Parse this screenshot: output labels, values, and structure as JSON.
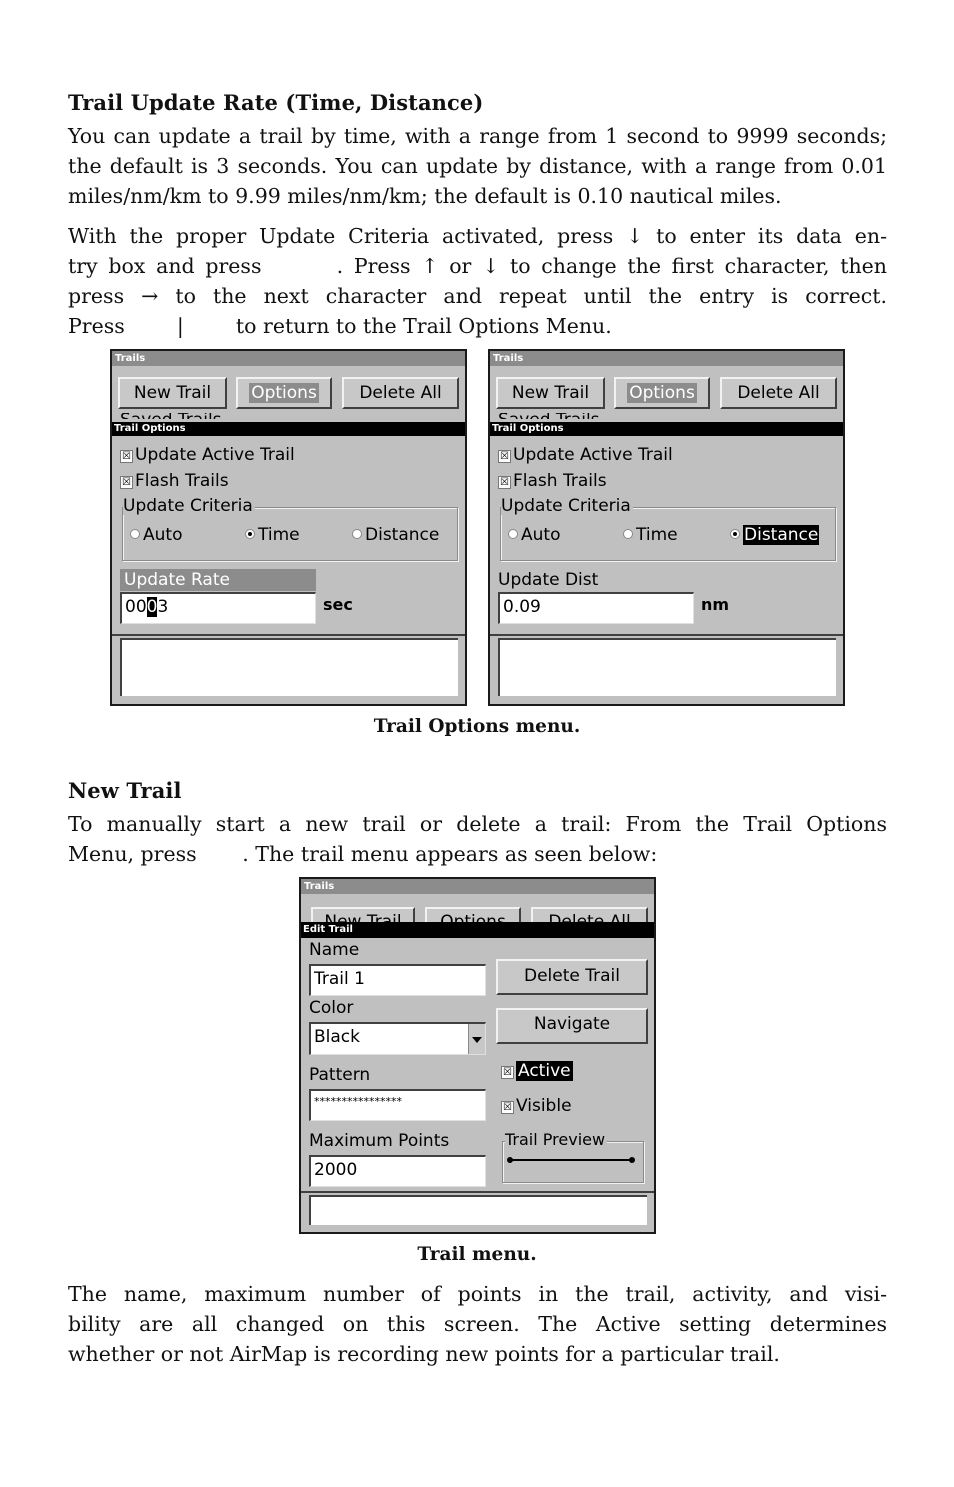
{
  "section1": {
    "heading": "Trail Update Rate (Time, Distance)",
    "para1_lines": [
      "You can update a trail by time, with a range from 1 second to 9999 seconds;",
      "the default is 3 seconds. You can update by distance, with a range from 0.01",
      "miles/nm/km to 9.99 miles/nm/km; the default is 0.10 nautical miles."
    ],
    "para2_lines": [
      "With the proper Update Criteria activated, press ↓ to enter its data en-",
      "try box and press       . Press ↑ or ↓ to change the first character, then",
      "press → to the next character and repeat until the entry is correct.",
      "Press        |        to return to the Trail Options Menu."
    ]
  },
  "figure1": {
    "caption": "Trail Options menu.",
    "screens": [
      {
        "title": "Trails",
        "buttons": {
          "new_trail": "New Trail",
          "options": "Options",
          "delete_all": "Delete All"
        },
        "partial_text": "Saved Trails",
        "submenu_title": "Trail Options",
        "checkboxes": [
          {
            "label": "Update Active Trail",
            "checked": true,
            "mark": "☒"
          },
          {
            "label": "Flash Trails",
            "checked": true,
            "mark": "☒"
          }
        ],
        "group_label": "Update Criteria",
        "radios": [
          {
            "label": "Auto",
            "selected": false
          },
          {
            "label": "Time",
            "selected": true
          },
          {
            "label": "Distance",
            "selected": false
          }
        ],
        "field_label": "Update Rate",
        "field_value_pre": "00",
        "field_value_cursor": "0",
        "field_value_post": "3",
        "unit": "sec"
      },
      {
        "title": "Trails",
        "buttons": {
          "new_trail": "New Trail",
          "options": "Options",
          "delete_all": "Delete All"
        },
        "partial_text": "Saved Trails",
        "submenu_title": "Trail Options",
        "checkboxes": [
          {
            "label": "Update Active Trail",
            "checked": true,
            "mark": "☒"
          },
          {
            "label": "Flash Trails",
            "checked": true,
            "mark": "☒"
          }
        ],
        "group_label": "Update Criteria",
        "radios": [
          {
            "label": "Auto",
            "selected": false
          },
          {
            "label": "Time",
            "selected": false
          },
          {
            "label": "Distance",
            "selected": true
          }
        ],
        "field_label": "Update Dist",
        "field_value": "0.09",
        "unit": "nm"
      }
    ]
  },
  "section2": {
    "heading": "New Trail",
    "para_lines": [
      "To manually start a new trail or delete a trail: From the Trail Options",
      "Menu, press       . The trail menu appears as seen below:"
    ]
  },
  "figure2": {
    "caption": "Trail menu.",
    "screen": {
      "title": "Trails",
      "partial_buttons": [
        "New Trail",
        "Options",
        "Delete All"
      ],
      "submenu_title": "Edit Trail",
      "name_label": "Name",
      "name_value": "Trail 1",
      "color_label": "Color",
      "color_value": "Black",
      "pattern_label": "Pattern",
      "pattern_value": "****************",
      "max_points_label": "Maximum Points",
      "max_points_value": "2000",
      "delete_trail": "Delete Trail",
      "navigate": "Navigate",
      "active_label": "Active",
      "active_mark": "☒",
      "visible_label": "Visible",
      "visible_mark": "☒",
      "preview_label": "Trail Preview"
    }
  },
  "section3": {
    "para_lines": [
      "The name, maximum number of points in the trail, activity, and visi-",
      "bility are all changed on this screen. The Active setting determines",
      "whether or not AirMap is recording new points for a particular trail."
    ]
  }
}
